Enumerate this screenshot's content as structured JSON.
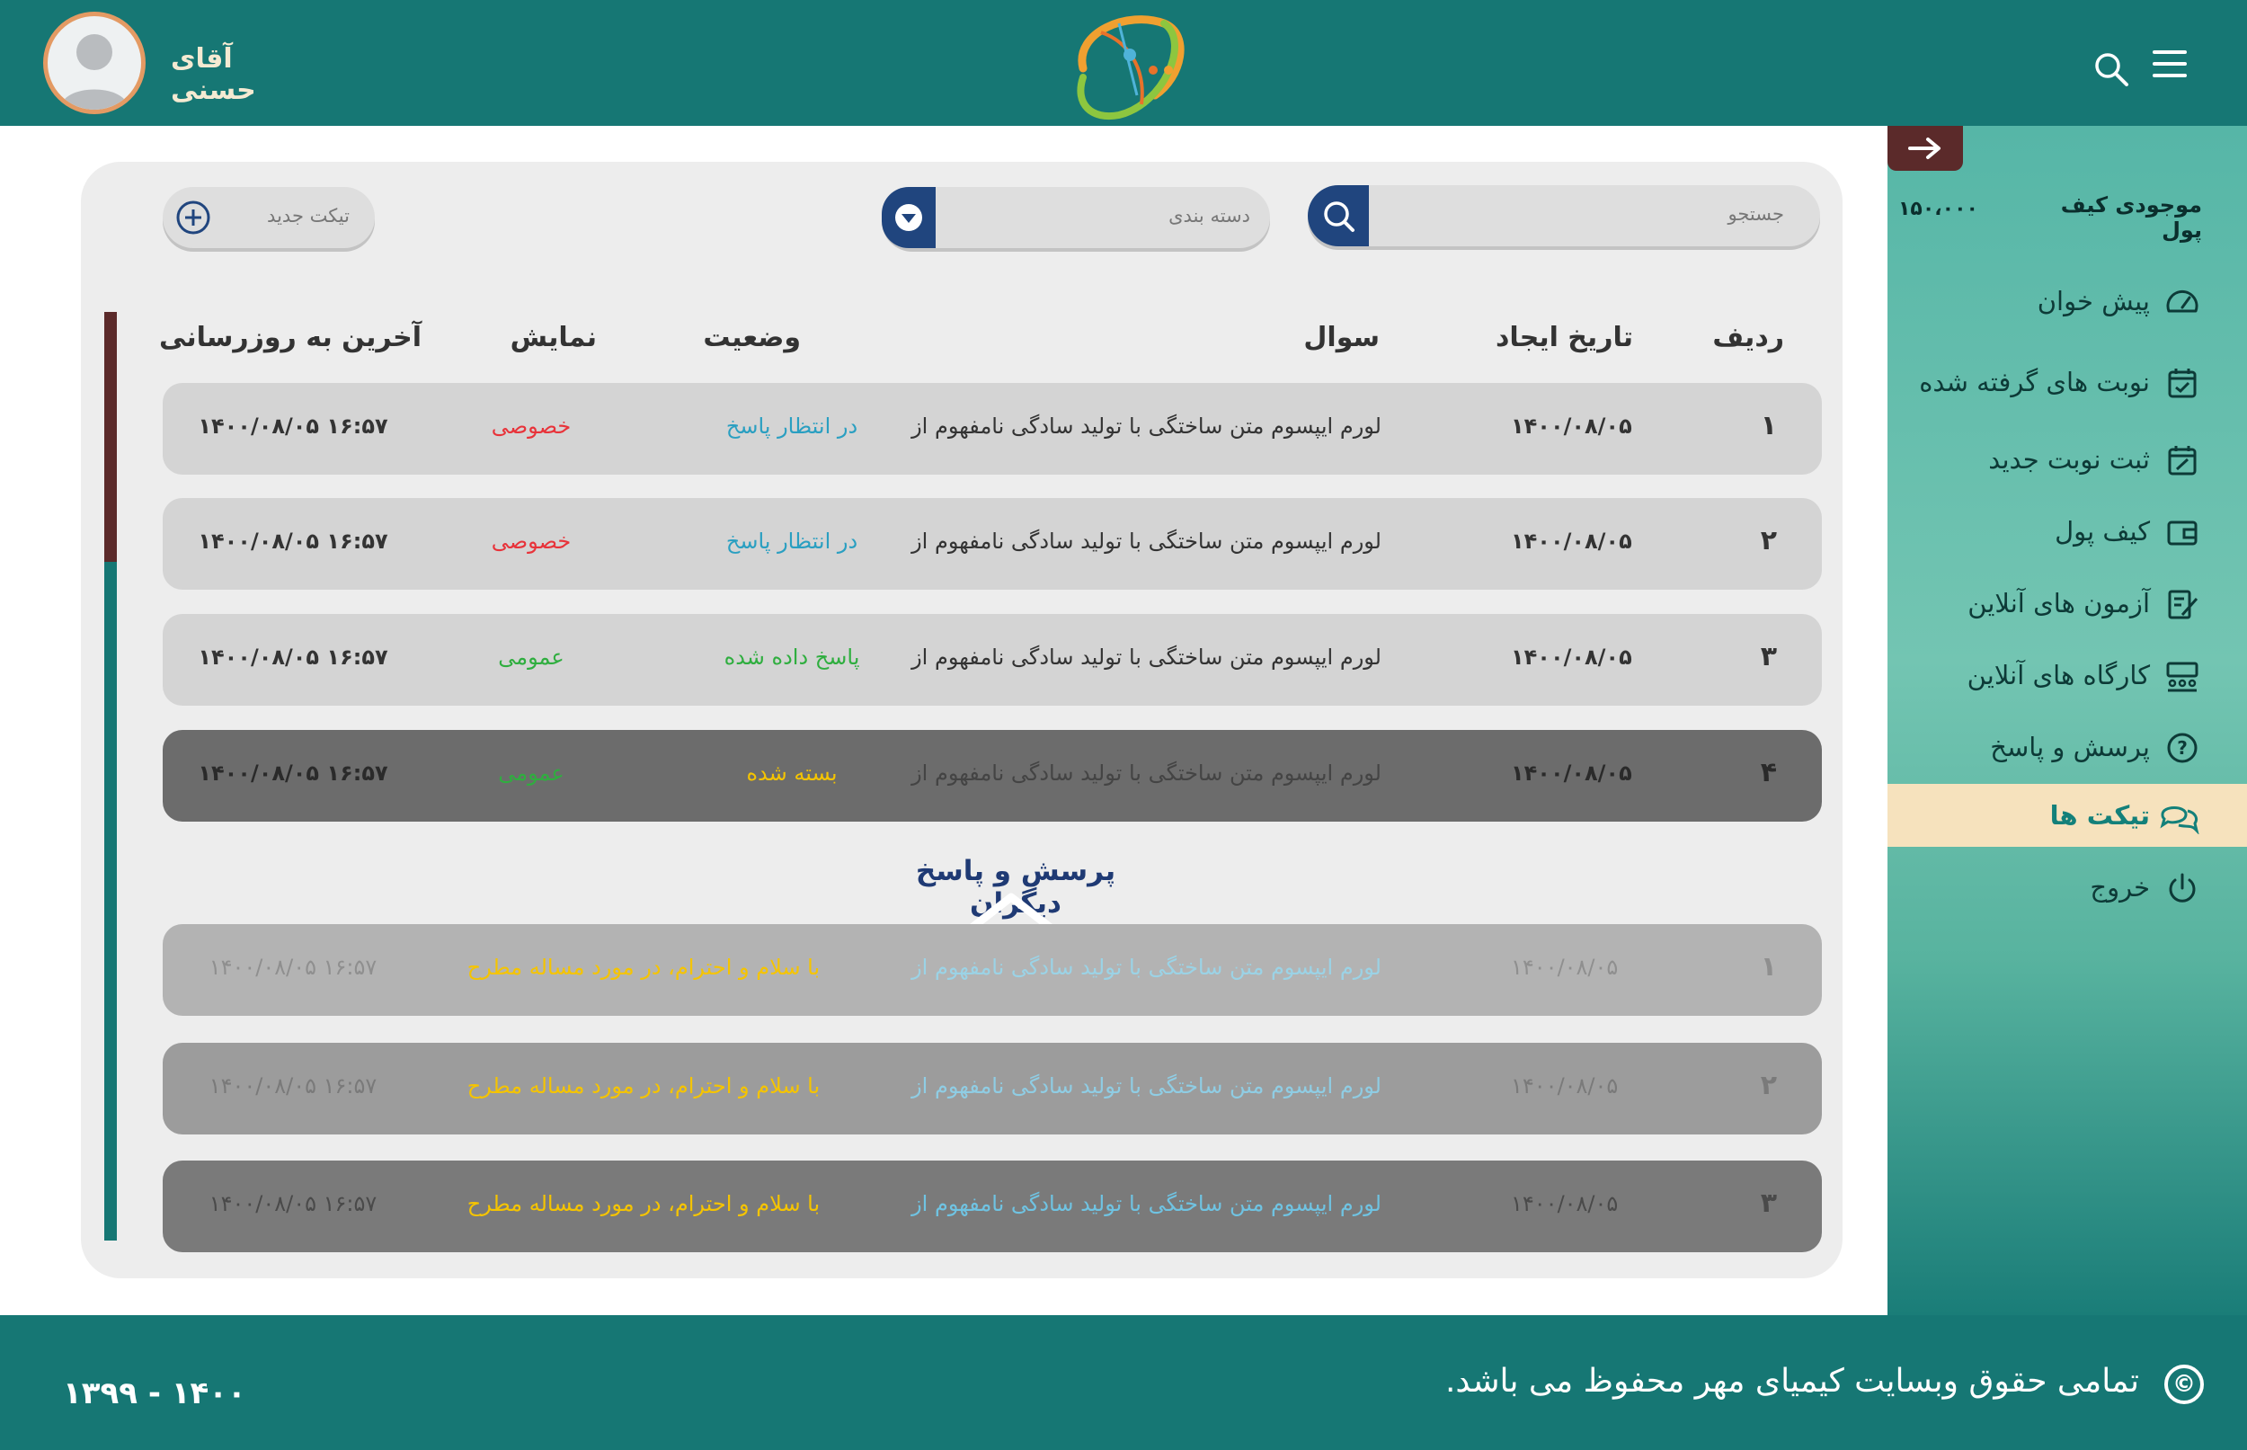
{
  "header": {
    "user_name": "آقای حسنی"
  },
  "sidebar": {
    "wallet_label": "موجودی کیف پول",
    "wallet_value": "۱۵۰،۰۰۰",
    "items": [
      {
        "label": "پیش خوان",
        "icon": "dashboard-gauge-icon"
      },
      {
        "label": "نوبت های گرفته شده",
        "icon": "calendar-check-icon"
      },
      {
        "label": "ثبت نوبت جدید",
        "icon": "calendar-edit-icon"
      },
      {
        "label": "کیف پول",
        "icon": "wallet-icon"
      },
      {
        "label": "آزمون های آنلاین",
        "icon": "exam-edit-icon"
      },
      {
        "label": "کارگاه های آنلاین",
        "icon": "workshop-group-icon"
      },
      {
        "label": "پرسش و پاسخ",
        "icon": "question-circle-icon"
      },
      {
        "label": "تیکت ها",
        "icon": "chat-bubbles-icon",
        "active": true
      },
      {
        "label": "خروج",
        "icon": "power-icon"
      }
    ]
  },
  "toolbar": {
    "search_placeholder": "جستجو",
    "category_placeholder": "دسته بندی",
    "new_ticket_label": "تیکت جدید"
  },
  "table": {
    "headers": {
      "index": "ردیف",
      "created": "تاریخ ایجاد",
      "question": "سوال",
      "status": "وضعیت",
      "visibility": "نمایش",
      "last_update": "آخرین به روزرسانی"
    },
    "rows": [
      {
        "index": "۱",
        "created": "۱۴۰۰/۰۸/۰۵",
        "question": "لورم ایپسوم متن ساختگی با تولید سادگی نامفهوم از",
        "status": "در انتظار پاسخ",
        "visibility": "خصوصی",
        "last_update": "۱۴۰۰/۰۸/۰۵ ۱۶:۵۷"
      },
      {
        "index": "۲",
        "created": "۱۴۰۰/۰۸/۰۵",
        "question": "لورم ایپسوم متن ساختگی با تولید سادگی نامفهوم از",
        "status": "در انتظار پاسخ",
        "visibility": "خصوصی",
        "last_update": "۱۴۰۰/۰۸/۰۵ ۱۶:۵۷"
      },
      {
        "index": "۳",
        "created": "۱۴۰۰/۰۸/۰۵",
        "question": "لورم ایپسوم متن ساختگی با تولید سادگی نامفهوم از",
        "status": "پاسخ داده شده",
        "visibility": "عمومی",
        "last_update": "۱۴۰۰/۰۸/۰۵ ۱۶:۵۷"
      },
      {
        "index": "۴",
        "created": "۱۴۰۰/۰۸/۰۵",
        "question": "لورم ایپسوم متن ساختگی با تولید سادگی نامفهوم از",
        "status": "بسته شده",
        "visibility": "عمومی",
        "last_update": "۱۴۰۰/۰۸/۰۵ ۱۶:۵۷"
      }
    ]
  },
  "others": {
    "title": "پرسش و پاسخ دیگران",
    "rows": [
      {
        "index": "۱",
        "created": "۱۴۰۰/۰۸/۰۵",
        "question": "لورم ایپسوم متن ساختگی با تولید سادگی نامفهوم از",
        "message": "با سلام و احترام، در مورد مساله مطرح",
        "last_update": "۱۴۰۰/۰۸/۰۵ ۱۶:۵۷"
      },
      {
        "index": "۲",
        "created": "۱۴۰۰/۰۸/۰۵",
        "question": "لورم ایپسوم متن ساختگی با تولید سادگی نامفهوم از",
        "message": "با سلام و احترام، در مورد مساله مطرح",
        "last_update": "۱۴۰۰/۰۸/۰۵ ۱۶:۵۷"
      },
      {
        "index": "۳",
        "created": "۱۴۰۰/۰۸/۰۵",
        "question": "لورم ایپسوم متن ساختگی با تولید سادگی نامفهوم از",
        "message": "با سلام و احترام، در مورد مساله مطرح",
        "last_update": "۱۴۰۰/۰۸/۰۵ ۱۶:۵۷"
      }
    ]
  },
  "footer": {
    "copyright_symbol": "©",
    "copyright": "تمامی حقوق وبسایت کیمیای مهر محفوظ می باشد.",
    "years": "۱۳۹۹ - ۱۴۰۰"
  },
  "colors": {
    "brand_teal": "#167774",
    "sidebar_green": "#73c5b2",
    "active_item_bg": "#f6e2bd",
    "button_navy": "#20457e",
    "accent_maroon": "#5b2a2a",
    "status_waiting": "#2a9fc1",
    "status_answered": "#2fae3f",
    "status_closed": "#f5c400",
    "visibility_private": "#e8333a",
    "visibility_public": "#2fae3f"
  }
}
